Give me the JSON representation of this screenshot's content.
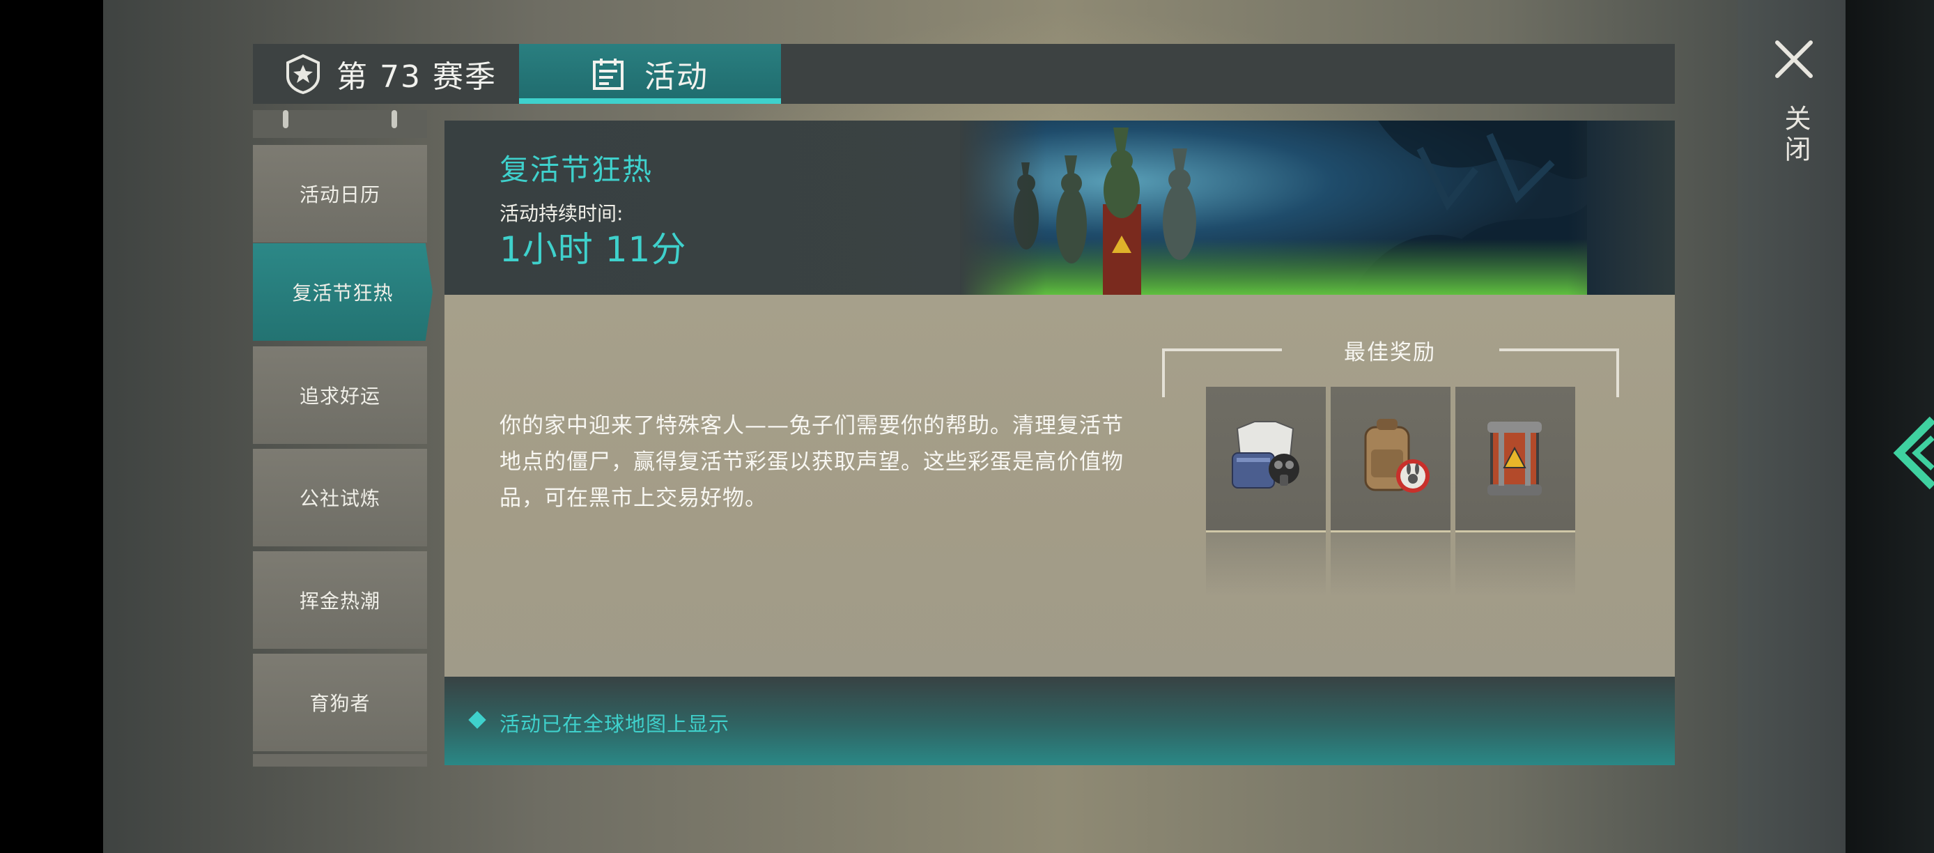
{
  "tabs": [
    {
      "label": "第 73 赛季",
      "icon": "season-shield-icon",
      "active": false
    },
    {
      "label": "活动",
      "icon": "calendar-icon",
      "active": true
    }
  ],
  "sidebar": {
    "items": [
      {
        "label": "活动日历",
        "active": false
      },
      {
        "label": "复活节狂热",
        "active": true
      },
      {
        "label": "追求好运",
        "active": false
      },
      {
        "label": "公社试炼",
        "active": false
      },
      {
        "label": "挥金热潮",
        "active": false
      },
      {
        "label": "育狗者",
        "active": false
      }
    ]
  },
  "event": {
    "title": "复活节狂热",
    "duration_label": "活动持续时间:",
    "duration_value": "1小时 11分",
    "description": "你的家中迎来了特殊客人——兔子们需要你的帮助。清理复活节地点的僵尸，赢得复活节彩蛋以获取声望。这些彩蛋是高价值物品，可在黑市上交易好物。",
    "banner_icon": "bunny-soldiers-banner"
  },
  "rewards": {
    "title": "最佳奖励",
    "items": [
      {
        "icon": "armor-gasmask-icon"
      },
      {
        "icon": "backpack-bunny-icon"
      },
      {
        "icon": "hazard-canister-icon"
      }
    ]
  },
  "footer": {
    "text": "活动已在全球地图上显示",
    "icon": "diamond-icon"
  },
  "close": {
    "label": "关闭",
    "icon": "close-icon"
  },
  "colors": {
    "accent": "#3fd1cc",
    "tab_active": "#237372",
    "header_bg": "#384041",
    "body_bg": "#a6a08b"
  }
}
